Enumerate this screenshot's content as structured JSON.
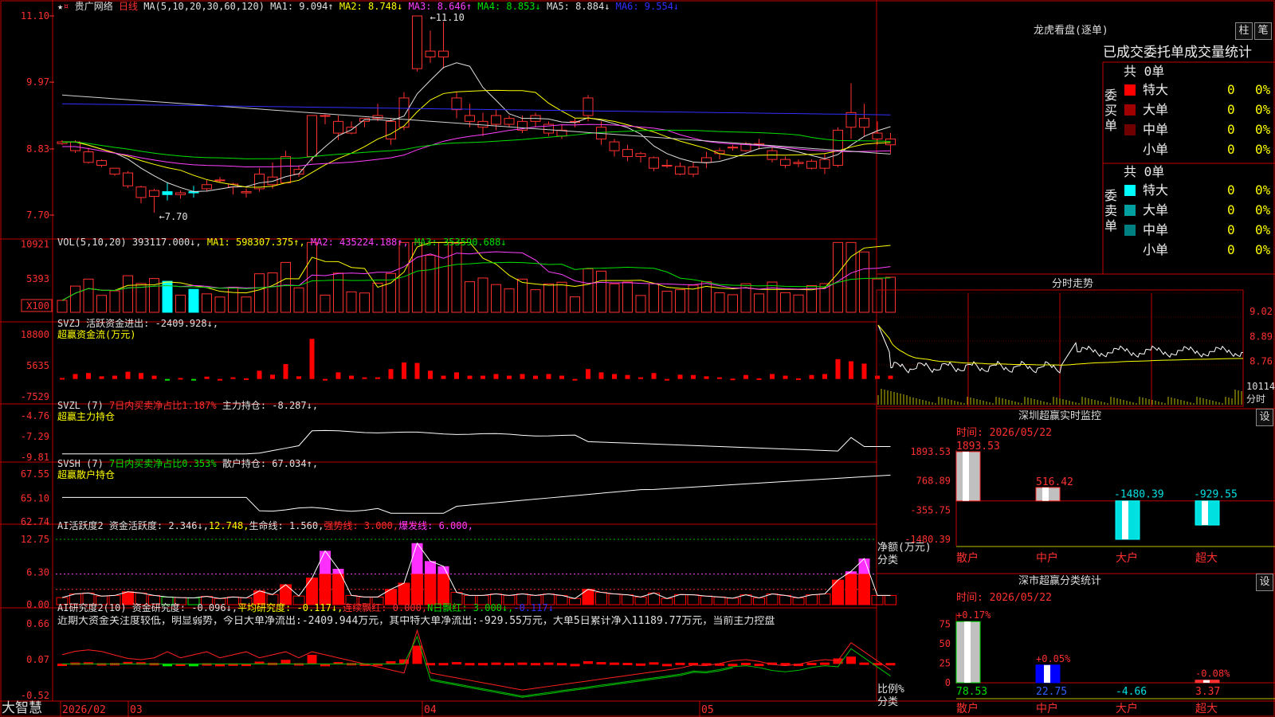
{
  "stock": {
    "name": "贵广网络",
    "period": "日线",
    "star": "★",
    "dot": "¤"
  },
  "main_chart": {
    "ma_header": "MA(5,10,20,30,60,120)",
    "ma_items": [
      {
        "label": "MA1: 9.094↑",
        "color": "#e0e0e0"
      },
      {
        "label": "MA2: 8.748↓",
        "color": "#ffff00"
      },
      {
        "label": "MA3: 8.646↑",
        "color": "#ff40ff"
      },
      {
        "label": "MA4: 8.853↓",
        "color": "#00e000"
      },
      {
        "label": "MA5: 8.884↓",
        "color": "#e0e0e0"
      },
      {
        "label": "MA6: 9.554↓",
        "color": "#3030ff"
      }
    ],
    "yticks": [
      "11.10",
      "9.97",
      "8.83",
      "7.70"
    ],
    "high_label": "11.10",
    "low_label": "7.70",
    "candles": [
      [
        8.92,
        8.98,
        8.95,
        8.9
      ],
      [
        8.8,
        8.98,
        8.95,
        8.76
      ],
      [
        8.6,
        8.85,
        8.78,
        8.58
      ],
      [
        8.55,
        8.65,
        8.63,
        8.52
      ],
      [
        8.4,
        8.5,
        8.5,
        8.37
      ],
      [
        8.2,
        8.45,
        8.42,
        8.16
      ],
      [
        8.0,
        8.2,
        8.18,
        7.9
      ],
      [
        8.02,
        8.15,
        8.12,
        7.74
      ],
      [
        8.1,
        8.25,
        8.05,
        7.95
      ],
      [
        8.05,
        8.12,
        8.08,
        7.98
      ],
      [
        8.1,
        8.2,
        8.08,
        8.0
      ],
      [
        8.15,
        8.3,
        8.22,
        8.1
      ],
      [
        8.3,
        8.35,
        8.3,
        8.25
      ],
      [
        8.18,
        8.25,
        8.23,
        8.05
      ],
      [
        8.08,
        8.15,
        8.1,
        8.0
      ],
      [
        8.15,
        8.5,
        8.4,
        8.1
      ],
      [
        8.22,
        8.6,
        8.35,
        8.15
      ],
      [
        8.25,
        8.8,
        8.7,
        8.25
      ],
      [
        8.4,
        8.55,
        8.48,
        8.35
      ],
      [
        8.7,
        9.4,
        9.4,
        8.62
      ],
      [
        9.4,
        9.42,
        9.4,
        9.25
      ],
      [
        9.1,
        9.4,
        9.3,
        8.98
      ],
      [
        9.1,
        9.3,
        9.2,
        9.08
      ],
      [
        9.3,
        9.35,
        9.35,
        9.2
      ],
      [
        9.35,
        9.6,
        9.4,
        9.3
      ],
      [
        9.0,
        9.35,
        9.3,
        8.9
      ],
      [
        9.2,
        9.8,
        9.7,
        9.15
      ],
      [
        10.2,
        11.1,
        11.1,
        10.15
      ],
      [
        10.4,
        10.85,
        10.5,
        10.3
      ],
      [
        10.4,
        11.0,
        10.5,
        10.2
      ],
      [
        9.5,
        9.8,
        9.7,
        9.35
      ],
      [
        9.3,
        9.6,
        9.4,
        9.2
      ],
      [
        9.2,
        9.45,
        9.3,
        9.05
      ],
      [
        9.25,
        9.5,
        9.4,
        9.15
      ],
      [
        9.25,
        9.4,
        9.35,
        9.2
      ],
      [
        9.15,
        9.4,
        9.3,
        9.1
      ],
      [
        9.3,
        9.45,
        9.4,
        9.2
      ],
      [
        9.1,
        9.3,
        9.25,
        9.05
      ],
      [
        9.05,
        9.25,
        9.15,
        9.0
      ],
      [
        9.3,
        9.35,
        9.3,
        9.2
      ],
      [
        9.4,
        9.75,
        9.7,
        9.3
      ],
      [
        9.0,
        9.3,
        9.2,
        8.9
      ],
      [
        8.8,
        9.0,
        8.95,
        8.7
      ],
      [
        8.7,
        8.9,
        8.82,
        8.62
      ],
      [
        8.7,
        8.78,
        8.75,
        8.6
      ],
      [
        8.5,
        8.7,
        8.68,
        8.45
      ],
      [
        8.55,
        8.65,
        8.55,
        8.5
      ],
      [
        8.4,
        8.6,
        8.53,
        8.38
      ],
      [
        8.4,
        8.6,
        8.52,
        8.35
      ],
      [
        8.6,
        8.78,
        8.68,
        8.5
      ],
      [
        8.75,
        8.85,
        8.8,
        8.65
      ],
      [
        8.85,
        8.9,
        8.86,
        8.8
      ],
      [
        8.8,
        8.95,
        8.92,
        8.78
      ],
      [
        8.9,
        9.0,
        8.92,
        8.82
      ],
      [
        8.65,
        8.85,
        8.8,
        8.6
      ],
      [
        8.55,
        8.7,
        8.65,
        8.5
      ],
      [
        8.58,
        8.65,
        8.6,
        8.52
      ],
      [
        8.5,
        8.65,
        8.62,
        8.48
      ],
      [
        8.5,
        8.75,
        8.65,
        8.4
      ],
      [
        8.55,
        9.2,
        9.15,
        8.52
      ],
      [
        9.2,
        9.95,
        9.45,
        9.0
      ],
      [
        9.2,
        9.6,
        9.35,
        9.05
      ],
      [
        9.0,
        9.3,
        9.1,
        8.9
      ],
      [
        8.9,
        9.1,
        9.0,
        8.75
      ]
    ]
  },
  "vol": {
    "header": "VOL(5,10,20) 393117.000↓,",
    "ma_items": [
      {
        "label": "MA1: 598307.375↑,",
        "color": "#ffff00"
      },
      {
        "label": "MA2: 435224.188↑,",
        "color": "#ff40ff"
      },
      {
        "label": "MA3: 353590.688↓",
        "color": "#00e000"
      }
    ],
    "yticks": [
      "10921",
      "5393"
    ],
    "unit": "X100"
  },
  "svzj": {
    "header": "SVZJ  活跃资金进出: -2409.928↓,",
    "sub": "超赢资金流(万元)",
    "yticks": [
      "18800",
      "5635",
      "-7529"
    ]
  },
  "svzl": {
    "header_a": "SVZL (7) ",
    "header_b": "7日内买卖净占比1.187%",
    "header_c": " 主力持仓: -8.287↓,",
    "sub": "超赢主力持仓",
    "yticks": [
      "-4.76",
      "-7.29",
      "-9.81"
    ]
  },
  "svsh": {
    "header_a": "SVSH (7) ",
    "header_b": "7日内买卖净占比0.353%",
    "header_c": " 散户持仓: 67.034↑,",
    "sub": "超赢散户持仓",
    "yticks": [
      "67.55",
      "65.10",
      "62.74"
    ]
  },
  "ai1": {
    "header_a": "AI活跃度2 资金活跃度: 2.346↓,",
    "header_b": "12.748,",
    "header_c": "生命线: 1.560,",
    "header_d": "强势线: 3.000,",
    "header_e": "爆发线: 6.000,",
    "yticks": [
      "12.75",
      "6.30",
      "0.00"
    ]
  },
  "ai2": {
    "header_a": "AI研究度2(10) 资金研究度: -0.096↓,",
    "header_b": "平均研究度: -0.117↓,",
    "header_c": "连续飘红: 0.000,",
    "header_d": "N日飘红: 3.000↓,",
    "header_e": "-0.117↓",
    "text": "近期大资金关注度较低，明显弱势，今日大单净流出:-2409.944万元，其中特大单净流出:-929.55万元，大单5日累计净入11189.77万元，当前主力控盘",
    "yticks": [
      "0.66",
      "0.07",
      "-0.52"
    ]
  },
  "footer": {
    "brand": "大智慧",
    "dates": [
      {
        "label": "2026/02",
        "color": "#ff3030"
      },
      {
        "label": "03",
        "color": "#ff3030"
      },
      {
        "label": "04",
        "color": "#ff3030"
      },
      {
        "label": "05",
        "color": "#ff3030"
      }
    ]
  },
  "longhu": {
    "title": "龙虎看盘(逐单)",
    "btn1": "柱",
    "btn2": "笔",
    "tabs": [
      "已成交",
      "委托单",
      "成交量统计"
    ],
    "buy": {
      "side": "委买单",
      "total": "共 0单",
      "rows": [
        {
          "label": "特大",
          "count": "0",
          "pct": "0%",
          "color": "#ff0000"
        },
        {
          "label": "大单",
          "count": "0",
          "pct": "0%",
          "color": "#a00000"
        },
        {
          "label": "中单",
          "count": "0",
          "pct": "0%",
          "color": "#700000"
        },
        {
          "label": "小单",
          "count": "0",
          "pct": "0%",
          "color": "#000000"
        }
      ]
    },
    "sell": {
      "side": "委卖单",
      "total": "共 0单",
      "rows": [
        {
          "label": "特大",
          "count": "0",
          "pct": "0%",
          "color": "#00ffff"
        },
        {
          "label": "大单",
          "count": "0",
          "pct": "0%",
          "color": "#00a0a0"
        },
        {
          "label": "中单",
          "count": "0",
          "pct": "0%",
          "color": "#008080"
        },
        {
          "label": "小单",
          "count": "0",
          "pct": "0%",
          "color": "#000000"
        }
      ]
    }
  },
  "intraday": {
    "title": "分时走势",
    "yticks": [
      "9.02",
      "8.89",
      "8.76"
    ],
    "vol_label": "10114",
    "vol_unit": "分时"
  },
  "sz_monitor": {
    "title": "深圳超赢实时监控",
    "btn": "设",
    "time": "时间: 2026/05/22",
    "yticks": [
      "1893.53",
      "768.89",
      "-355.75",
      "-1480.39"
    ],
    "ylabel": "净额(万元)",
    "xlabel": "分类",
    "bars": [
      {
        "cat": "散户",
        "value": 1893.53,
        "label": "1893.53"
      },
      {
        "cat": "中户",
        "value": 516.42,
        "label": "516.42"
      },
      {
        "cat": "大户",
        "value": -1480.39,
        "label": "-1480.39"
      },
      {
        "cat": "超大",
        "value": -929.55,
        "label": "-929.55"
      }
    ]
  },
  "sz_class": {
    "title": "深市超赢分类统计",
    "btn": "设",
    "time": "时间: 2026/05/22",
    "yticks": [
      "75",
      "50",
      "25",
      "0"
    ],
    "ylabel": "比例%",
    "xlabel": "分类",
    "bars": [
      {
        "cat": "散户",
        "value": 78.53,
        "label": "78.53",
        "delta": "+0.17%"
      },
      {
        "cat": "中户",
        "value": 22.75,
        "label": "22.75",
        "delta": "+0.05%"
      },
      {
        "cat": "大户",
        "value": -4.66,
        "label": "-4.66",
        "delta": ""
      },
      {
        "cat": "超大",
        "value": 3.37,
        "label": "3.37",
        "delta": "-0.08%"
      }
    ]
  }
}
